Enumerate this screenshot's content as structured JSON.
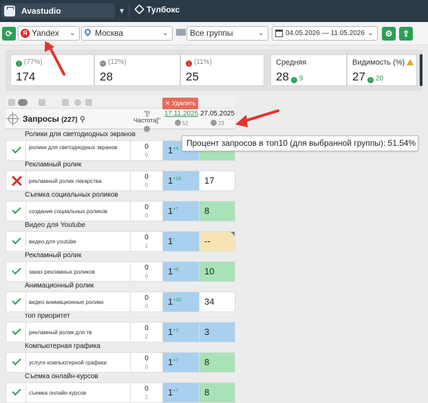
{
  "topbar": {
    "project": "Avastudio",
    "toolbox": "Тулбокс"
  },
  "filters": {
    "search_engine": "Yandex",
    "region": "Москва",
    "group": "Все группы",
    "date_range": "04.05.2026 — 11.05.2026"
  },
  "stats": {
    "top3": {
      "pct": "(77%)",
      "value": "174"
    },
    "neutral": {
      "pct": "(12%)",
      "value": "28"
    },
    "down": {
      "pct": "(11%)",
      "value": "25"
    },
    "avg": {
      "title": "Средняя",
      "value": "28",
      "delta": "9"
    },
    "visibility": {
      "title": "Видимость (%)",
      "value": "27",
      "delta": "20"
    }
  },
  "table": {
    "queries_label": "Запросы",
    "queries_count": "(227)",
    "freq_header": "\"[!Частота]\"",
    "date_a": "17.11.2025",
    "date_a_count": "52",
    "date_b": "27.05.2025",
    "date_b_count": "23",
    "delete_label": "✕ Удалить",
    "tooltip": "Процент запросов в топ10 (для выбранной группы): 51.54%",
    "rows": [
      {
        "group": "Ролики для светодиодных экранов",
        "keyword": "ролики для светодиодных экранов",
        "f1": "0",
        "f2": "0",
        "pos": "1",
        "delta": "+4",
        "prev": "",
        "status": "ok"
      },
      {
        "group": "Рекламный ролик",
        "keyword": "рекламный ролик лекарства",
        "f1": "0",
        "f2": "0",
        "pos": "1",
        "delta": "+16",
        "prev": "17",
        "status": "fail"
      },
      {
        "group": "Съемка социальных роликов",
        "keyword": "создание социальных роликов",
        "f1": "0",
        "f2": "0",
        "pos": "1",
        "delta": "+7",
        "prev": "8",
        "status": "ok"
      },
      {
        "group": "Видео для Youtube",
        "keyword": "видео для youtube",
        "f1": "0",
        "f2": "1",
        "pos": "1",
        "delta": "↑",
        "prev": "--",
        "status": "ok"
      },
      {
        "group": "Рекламный ролик",
        "keyword": "заказ рекламных роликов",
        "f1": "0",
        "f2": "0",
        "pos": "1",
        "delta": "+9",
        "prev": "10",
        "status": "ok"
      },
      {
        "group": "Анимационный ролик",
        "keyword": "видео анимационные ролики",
        "f1": "0",
        "f2": "0",
        "pos": "1",
        "delta": "+33",
        "prev": "34",
        "status": "ok"
      },
      {
        "group": "топ приоритет",
        "keyword": "рекламный ролик для тв",
        "f1": "0",
        "f2": "2",
        "pos": "1",
        "delta": "+2",
        "prev": "3",
        "status": "ok"
      },
      {
        "group": "Компьютерная графика",
        "keyword": "услуги компьютерной графики",
        "f1": "0",
        "f2": "0",
        "pos": "1",
        "delta": "+7",
        "prev": "8",
        "status": "ok"
      },
      {
        "group": "Съемка онлайн-курсов",
        "keyword": "съемка онлайн курсов",
        "f1": "0",
        "f2": "1",
        "pos": "1",
        "delta": "+7",
        "prev": "8",
        "status": "ok"
      }
    ]
  },
  "colors": {
    "accent_green": "#2e9e57",
    "pos_blue": "#a9d0ef",
    "prev_green": "#a9e2b6",
    "prev_cream": "#f6e4b5",
    "arrow_red": "#e0342c",
    "delete_red": "#e86a5a"
  }
}
